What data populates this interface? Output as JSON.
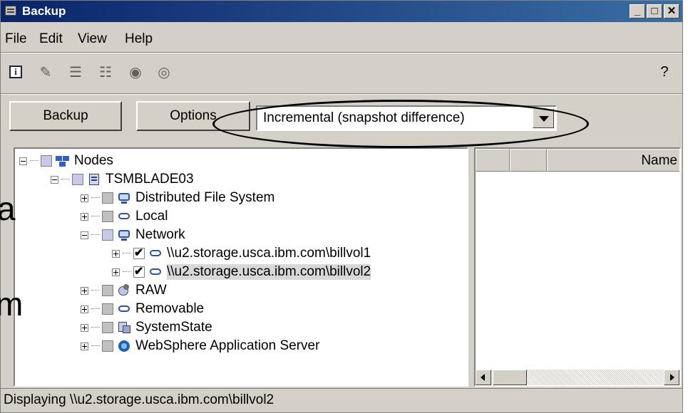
{
  "window": {
    "title": "Backup"
  },
  "menu": {
    "items": [
      "File",
      "Edit",
      "View",
      "Help"
    ]
  },
  "toolbar": {
    "icons": [
      "info-icon",
      "brush-icon",
      "list-icon",
      "list-details-icon",
      "disabled-circle-icon",
      "ring-icon"
    ],
    "help_glyph": "?"
  },
  "actions": {
    "backup_label": "Backup",
    "options_label": "Options",
    "backup_type": "Incremental (snapshot difference)"
  },
  "tree": {
    "root": "Nodes",
    "node": "TSMBLADE03",
    "items": [
      {
        "label": "Distributed File System"
      },
      {
        "label": "Local"
      },
      {
        "label": "Network"
      },
      {
        "label": "\\\\u2.storage.usca.ibm.com\\billvol1"
      },
      {
        "label": "\\\\u2.storage.usca.ibm.com\\billvol2"
      },
      {
        "label": "RAW"
      },
      {
        "label": "Removable"
      },
      {
        "label": "SystemState"
      },
      {
        "label": "WebSphere Application Server"
      }
    ]
  },
  "list": {
    "column_name": "Name"
  },
  "status": {
    "text": "Displaying \\\\u2.storage.usca.ibm.com\\billvol2"
  },
  "colors": {
    "title_bar": "#0a246a",
    "chrome": "#d4d0c8",
    "highlight_ellipse": "#000000"
  }
}
